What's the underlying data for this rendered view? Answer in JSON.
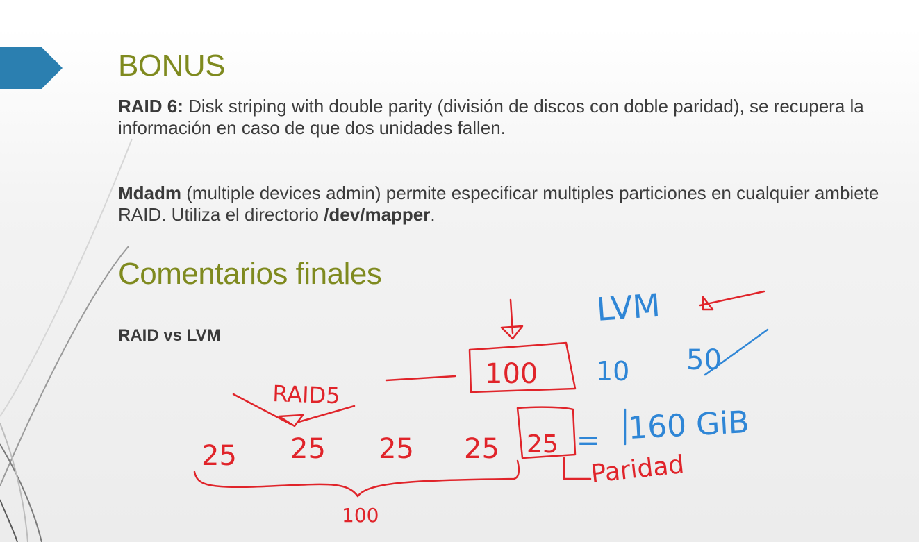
{
  "slide": {
    "bonus_heading": "BONUS",
    "raid6": {
      "label": "RAID 6:",
      "text": " Disk striping with double parity (división de discos con doble paridad), se recupera la información en caso de que dos unidades fallen."
    },
    "mdadm": {
      "label": "Mdadm",
      "text_before": " (multiple devices admin) permite especificar multiples particiones en cualquier ambiete RAID. Utiliza el directorio ",
      "path": "/dev/mapper",
      "text_after": "."
    },
    "final_heading": "Comentarios finales",
    "raid_vs_lvm": "RAID vs LVM"
  },
  "annotations": {
    "colors": {
      "red_ink": "#e0242a",
      "blue_ink": "#2f86d6",
      "heading_green": "#7f8a1f",
      "ribbon_blue": "#2b7fb0"
    },
    "red": {
      "raid5": "RAID5",
      "box_value": "100",
      "disks": [
        "25",
        "25",
        "25",
        "25"
      ],
      "parity_disk": "25",
      "total": "100",
      "parity_label": "Paridad"
    },
    "blue": {
      "lvm": "LVM",
      "ten": "10",
      "fifty": "50",
      "equals": "=",
      "result": "160 GiB"
    }
  }
}
